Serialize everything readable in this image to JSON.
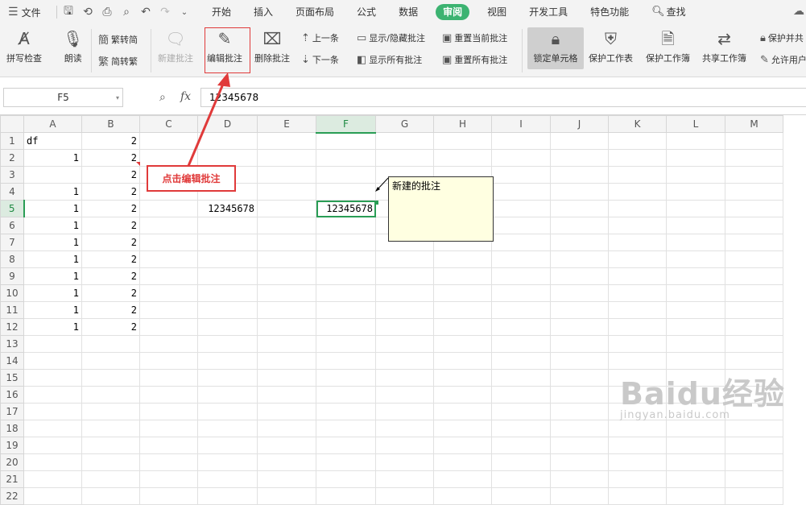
{
  "menubar": {
    "file_label": "文件",
    "tabs": [
      "开始",
      "插入",
      "页面布局",
      "公式",
      "数据",
      "审阅",
      "视图",
      "开发工具",
      "特色功能"
    ],
    "active_tab": "审阅",
    "search_label": "查找"
  },
  "ribbon": {
    "spellcheck": "拼写检查",
    "read_aloud": "朗读",
    "trad_to_simp": "繁转简",
    "simp_to_trad": "简转繁",
    "new_comment": "新建批注",
    "edit_comment": "编辑批注",
    "delete_comment": "删除批注",
    "prev_comment": "上一条",
    "next_comment": "下一条",
    "show_hide_comment": "显示/隐藏批注",
    "show_all_comments": "显示所有批注",
    "reset_current_comment": "重置当前批注",
    "reset_all_comments": "重置所有批注",
    "lock_cell": "锁定单元格",
    "protect_sheet": "保护工作表",
    "protect_workbook": "保护工作簿",
    "share_workbook": "共享工作簿",
    "protect_share": "保护并共",
    "allow_edit": "允许用户"
  },
  "formula_bar": {
    "name_box": "F5",
    "fx": "fx",
    "content": "12345678"
  },
  "grid": {
    "columns": [
      "A",
      "B",
      "C",
      "D",
      "E",
      "F",
      "G",
      "H",
      "I",
      "J",
      "K",
      "L",
      "M"
    ],
    "rows": [
      {
        "n": "1",
        "A": "df",
        "B": "2"
      },
      {
        "n": "2",
        "A": "1",
        "B": "2"
      },
      {
        "n": "3",
        "A": "",
        "B": "2"
      },
      {
        "n": "4",
        "A": "1",
        "B": "2"
      },
      {
        "n": "5",
        "A": "1",
        "B": "2",
        "D": "12345678",
        "F": "12345678"
      },
      {
        "n": "6",
        "A": "1",
        "B": "2"
      },
      {
        "n": "7",
        "A": "1",
        "B": "2"
      },
      {
        "n": "8",
        "A": "1",
        "B": "2"
      },
      {
        "n": "9",
        "A": "1",
        "B": "2"
      },
      {
        "n": "10",
        "A": "1",
        "B": "2"
      },
      {
        "n": "11",
        "A": "1",
        "B": "2"
      },
      {
        "n": "12",
        "A": "1",
        "B": "2"
      },
      {
        "n": "13"
      },
      {
        "n": "14"
      },
      {
        "n": "15"
      },
      {
        "n": "16"
      },
      {
        "n": "17"
      },
      {
        "n": "18"
      },
      {
        "n": "19"
      },
      {
        "n": "20"
      },
      {
        "n": "21"
      },
      {
        "n": "22"
      }
    ],
    "selected_column": "F",
    "selected_row": "5"
  },
  "comment": {
    "text": "新建的批注"
  },
  "annotation": {
    "callout_text": "点击编辑批注",
    "color": "#e03a3a"
  },
  "watermark": {
    "main": "Baidu经验",
    "sub": "jingyan.baidu.com"
  },
  "colors": {
    "accent_green": "#2a9d55",
    "tab_active_bg": "#3cb371",
    "comment_bg": "#ffffe1"
  }
}
